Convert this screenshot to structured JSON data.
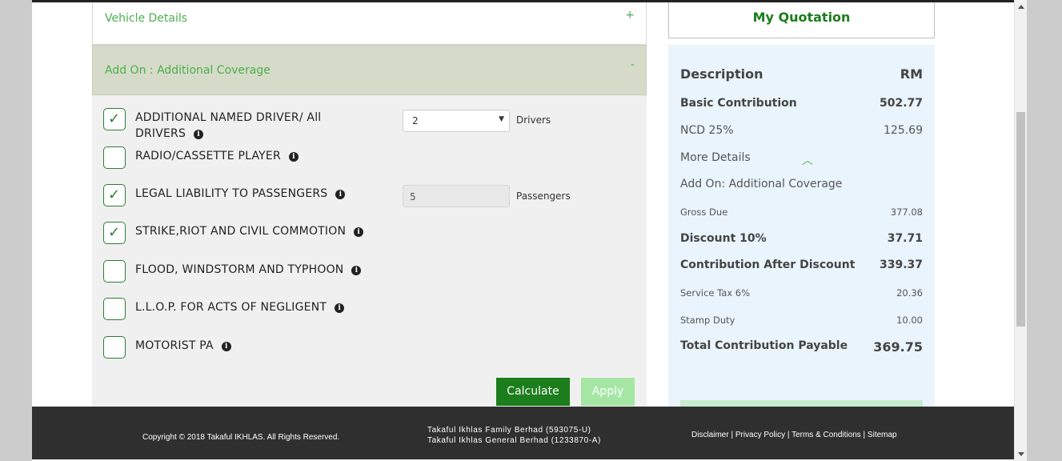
{
  "vehicle_details": {
    "title": "Vehicle Details",
    "toggle": "+"
  },
  "addon": {
    "title": "Add On : Additional Coverage",
    "toggle": "-",
    "options": [
      {
        "label": "ADDITIONAL NAMED DRIVER/ All DRIVERS",
        "checked": true
      },
      {
        "label": "RADIO/CASSETTE PLAYER",
        "checked": false
      },
      {
        "label": "LEGAL LIABILITY TO PASSENGERS",
        "checked": true
      },
      {
        "label": "STRIKE,RIOT AND CIVIL COMMOTION",
        "checked": true
      },
      {
        "label": "FLOOD, WINDSTORM AND TYPHOON",
        "checked": false
      },
      {
        "label": "L.L.O.P. FOR ACTS OF NEGLIGENT",
        "checked": false
      },
      {
        "label": "MOTORIST PA",
        "checked": false
      }
    ],
    "drivers_value": "2",
    "drivers_unit": "Drivers",
    "passengers_value": "5",
    "passengers_unit": "Passengers",
    "calculate_label": "Calculate",
    "apply_label": "Apply",
    "check_glyph": "✓",
    "info_glyph": "i"
  },
  "quotation": {
    "title": "My Quotation",
    "description_label": "Description",
    "currency_label": "RM",
    "basic_contribution": {
      "label": "Basic Contribution",
      "value": "502.77"
    },
    "ncd": {
      "label": "NCD 25%",
      "value": "125.69"
    },
    "more_details": "More Details",
    "addon_label": "Add On: Additional Coverage",
    "gross_due": {
      "label": "Gross Due",
      "value": "377.08"
    },
    "discount": {
      "label": "Discount 10%",
      "value": "37.71"
    },
    "after_discount": {
      "label": "Contribution After Discount",
      "value": "339.37"
    },
    "service_tax": {
      "label": "Service Tax 6%",
      "value": "20.36"
    },
    "stamp_duty": {
      "label": "Stamp Duty",
      "value": "10.00"
    },
    "total": {
      "label": "Total Contribution Payable",
      "value": "369.75"
    }
  },
  "footer": {
    "copyright": "Copyright © 2018 Takaful IKHLAS. All Rights Reserved.",
    "company_line1": "Takaful Ikhlas Family Berhad (593075-U)",
    "company_line2": "Takaful Ikhlas General Berhad (1233870-A)",
    "links": [
      "Disclaimer",
      "Privacy Policy",
      "Terms & Conditions",
      "Sitemap"
    ],
    "separator": " | "
  },
  "colors": {
    "accent_green": "#1b7d1b",
    "light_green": "#4caf50",
    "addon_header_bg": "#d5dbc8",
    "quotation_bg": "#eaf4fc",
    "footer_bg": "#2f2f2f"
  },
  "icons": [
    "info-icon",
    "check-icon",
    "chevron-up-icon",
    "plus-icon",
    "minus-icon",
    "dropdown-arrow-icon"
  ]
}
